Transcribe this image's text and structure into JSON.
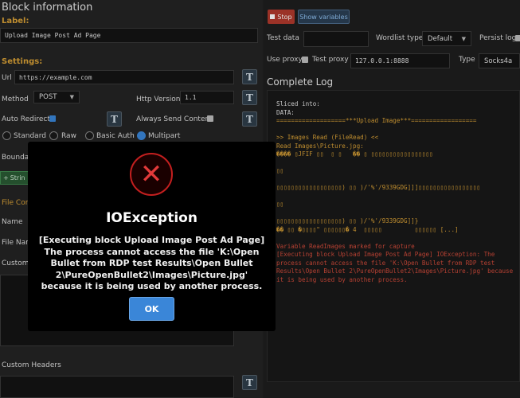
{
  "block": {
    "title": "Block information",
    "label_heading": "Label:",
    "label_value": "Upload Image Post Ad Page",
    "settings_heading": "Settings:",
    "url_label": "Url",
    "url_value": "https://example.com",
    "method_label": "Method",
    "method_value": "POST",
    "http_version_label": "Http Version",
    "http_version_value": "1.1",
    "auto_redirect_label": "Auto Redirect",
    "always_send_content_label": "Always Send Content",
    "radio_options": [
      "Standard",
      "Raw",
      "Basic Auth",
      "Multipart"
    ],
    "boundary_label": "Boundary",
    "string_button": "Strin",
    "file_content_heading": "File Cont",
    "name_label": "Name",
    "file_name_label": "File Nam",
    "custom_label": "Custom C",
    "custom_headers_label": "Custom Headers",
    "t_icon": "T"
  },
  "runner": {
    "stop_button": "Stop",
    "show_variables_button": "Show variables",
    "test_data_label": "Test data",
    "test_data_value": "",
    "wordlist_type_label": "Wordlist type",
    "wordlist_type_value": "Default",
    "persist_log_label": "Persist log",
    "use_proxy_label": "Use proxy",
    "test_proxy_label": "Test proxy",
    "test_proxy_value": "127.0.0.1:8888",
    "type_label": "Type",
    "type_value": "Socks4a"
  },
  "log": {
    "title": "Complete Log",
    "lines": [
      {
        "text": "Sliced into:",
        "color": "w"
      },
      {
        "text": "DATA:",
        "color": "w"
      },
      {
        "text": "===================***Upload Image***==================",
        "color": "o"
      },
      {
        "text": "",
        "color": "w"
      },
      {
        "text": ">> Images Read (FileRead) <<",
        "color": "o"
      },
      {
        "text": "Read Images\\Picture.jpg:",
        "color": "o"
      },
      {
        "text": "���� ▯JFIF ▯▯  ▯ ▯   �� ▯ ▯▯▯▯▯▯▯▯▯▯▯▯▯▯▯▯▯",
        "color": "o"
      },
      {
        "text": "",
        "color": "w"
      },
      {
        "text": "▯▯",
        "color": "o"
      },
      {
        "text": "",
        "color": "w"
      },
      {
        "text": "▯▯▯▯▯▯▯▯▯▯▯▯▯▯▯▯▯▯) ▯▯ )/'%'/9339GDG]]]▯▯▯▯▯▯▯▯▯▯▯▯▯▯▯▯▯",
        "color": "o"
      },
      {
        "text": "",
        "color": "w"
      },
      {
        "text": "▯▯",
        "color": "o"
      },
      {
        "text": "",
        "color": "w"
      },
      {
        "text": "▯▯▯▯▯▯▯▯▯▯▯▯▯▯▯▯▯▯) ▯▯ )/'%'/9339GDG]]}",
        "color": "o"
      },
      {
        "text": "�� ▯▯ �▯▯▯▯\" ▯▯▯▯▯▯� 4  ▯▯▯▯▯         ▯▯▯▯▯▯ [...]",
        "color": "o"
      },
      {
        "text": "",
        "color": "w"
      },
      {
        "text": "Variable ReadImages marked for capture",
        "color": "r"
      },
      {
        "text": "[Executing block Upload Image Post Ad Page] IOException: The",
        "color": "r"
      },
      {
        "text": "process cannot access the file 'K:\\Open Bullet from RDP test",
        "color": "r"
      },
      {
        "text": "Results\\Open Bullet 2\\PureOpenBullet2\\Images\\Picture.jpg' because",
        "color": "r"
      },
      {
        "text": "it is being used by another process.",
        "color": "r"
      }
    ]
  },
  "modal": {
    "title": "IOException",
    "message": "[Executing block Upload Image Post Ad Page] The process cannot access the file 'K:\\Open Bullet from RDP test Results\\Open Bullet 2\\PureOpenBullet2\\Images\\Picture.jpg' because it is being used by another process.",
    "ok_button": "OK",
    "icon": "error-x-icon",
    "icon_glyph": "✕"
  },
  "colors": {
    "accent_orange": "#d8a036",
    "error_red": "#d04a3a",
    "ok_blue": "#3a86d8",
    "stop_red": "#b13a2d"
  }
}
